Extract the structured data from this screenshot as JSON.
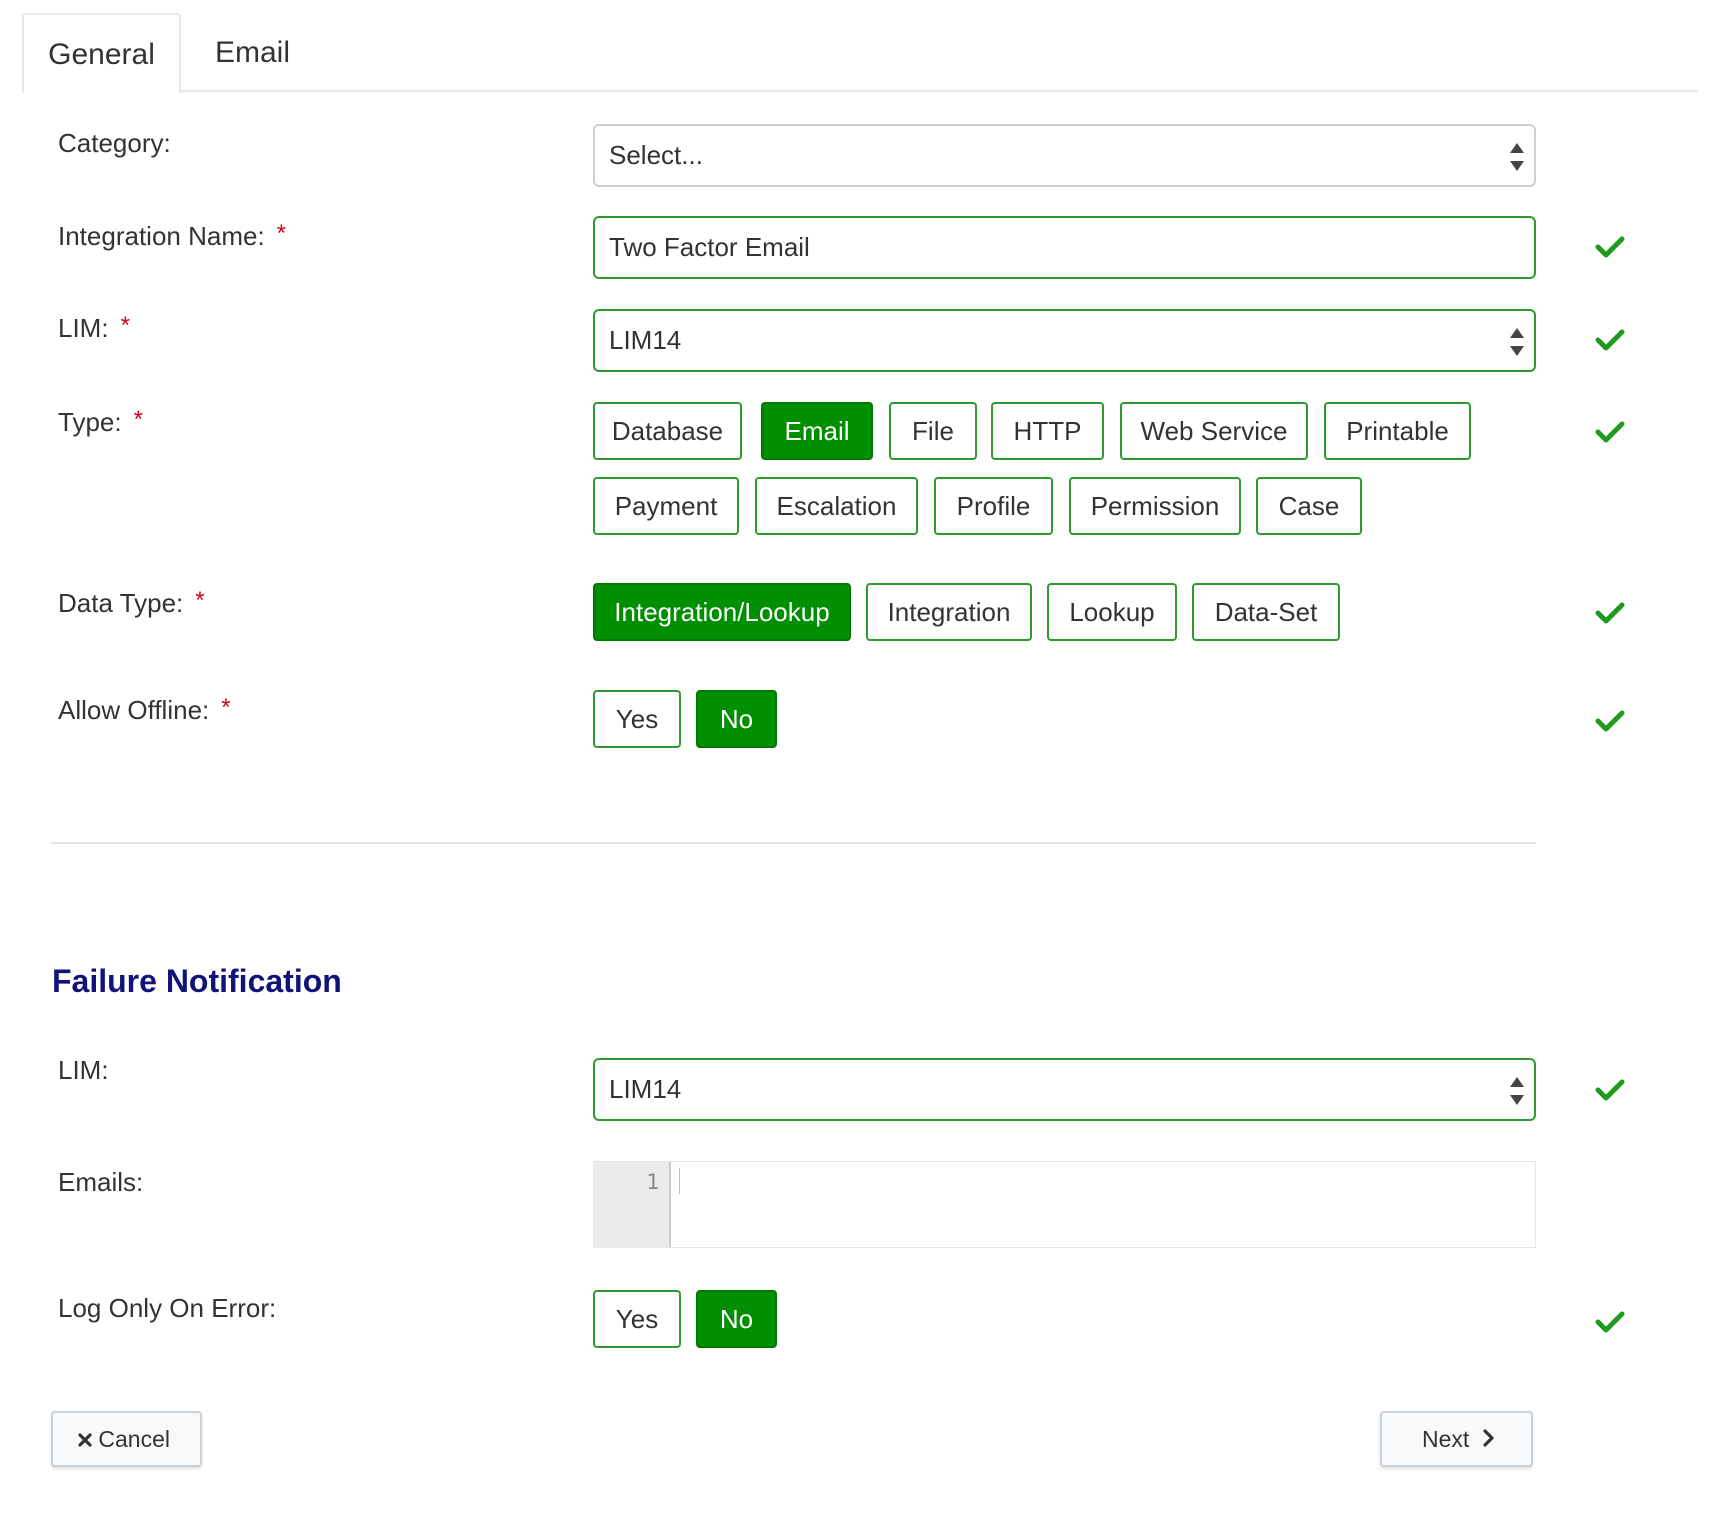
{
  "tabs": [
    {
      "label": "General",
      "active": true
    },
    {
      "label": "Email",
      "active": false
    }
  ],
  "general": {
    "category": {
      "label": "Category:",
      "value": "Select..."
    },
    "integration_name": {
      "label": "Integration Name:",
      "required": "*",
      "value": "Two Factor Email"
    },
    "lim": {
      "label": "LIM:",
      "required": "*",
      "value": "LIM14"
    },
    "type": {
      "label": "Type:",
      "required": "*",
      "options": [
        "Database",
        "Email",
        "File",
        "HTTP",
        "Web Service",
        "Printable",
        "Payment",
        "Escalation",
        "Profile",
        "Permission",
        "Case"
      ],
      "selected": "Email"
    },
    "data_type": {
      "label": "Data Type:",
      "required": "*",
      "options": [
        "Integration/Lookup",
        "Integration",
        "Lookup",
        "Data-Set"
      ],
      "selected": "Integration/Lookup"
    },
    "allow_offline": {
      "label": "Allow Offline:",
      "required": "*",
      "options": [
        "Yes",
        "No"
      ],
      "selected": "No"
    }
  },
  "failure_notification": {
    "title": "Failure Notification",
    "lim": {
      "label": "LIM:",
      "value": "LIM14"
    },
    "emails": {
      "label": "Emails:",
      "line_number": "1",
      "value": ""
    },
    "log_only_on_error": {
      "label": "Log Only On Error:",
      "options": [
        "Yes",
        "No"
      ],
      "selected": "No"
    }
  },
  "footer": {
    "cancel_label": "Cancel",
    "next_label": "Next"
  },
  "colors": {
    "accent_green": "#008f00",
    "valid_check": "#1f9a1f",
    "required_star": "#d0021b",
    "section_title": "#11127a"
  },
  "icons": {
    "valid": "check-icon",
    "select": "select-arrows-icon",
    "cancel": "times-icon",
    "next": "chevron-right-icon"
  }
}
